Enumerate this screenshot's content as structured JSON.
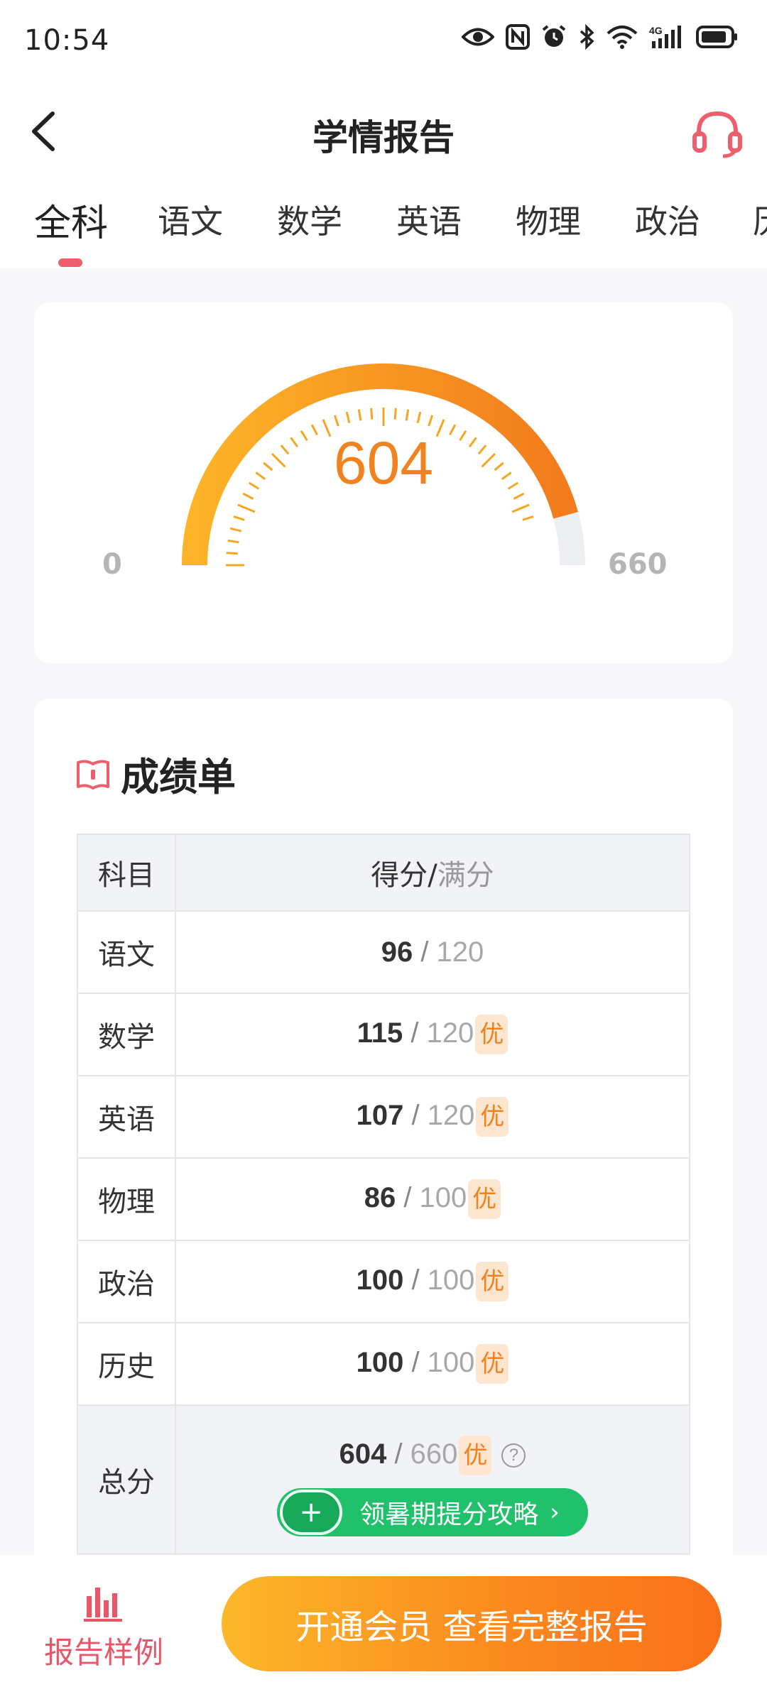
{
  "status_bar": {
    "time": "10:54",
    "icons": [
      "eye-icon",
      "nfc-icon",
      "alarm-icon",
      "bluetooth-icon",
      "wifi-icon",
      "signal-4g-icon",
      "battery-icon"
    ]
  },
  "nav": {
    "title": "学情报告",
    "back_icon": "chevron-left-icon",
    "support_icon": "headset-icon"
  },
  "tabs": [
    {
      "label": "全科",
      "active": true
    },
    {
      "label": "语文",
      "active": false
    },
    {
      "label": "数学",
      "active": false
    },
    {
      "label": "英语",
      "active": false
    },
    {
      "label": "物理",
      "active": false
    },
    {
      "label": "政治",
      "active": false
    },
    {
      "label": "历",
      "active": false
    }
  ],
  "gauge": {
    "score": "604",
    "min": "0",
    "max": "660",
    "fraction": 0.915
  },
  "report": {
    "title": "成绩单",
    "icon": "book-icon",
    "headers": {
      "subject": "科目",
      "score": "得分",
      "slash": "/",
      "full": "满分"
    },
    "rows": [
      {
        "subject": "语文",
        "score": "96",
        "full": "120",
        "badge": ""
      },
      {
        "subject": "数学",
        "score": "115",
        "full": "120",
        "badge": "优"
      },
      {
        "subject": "英语",
        "score": "107",
        "full": "120",
        "badge": "优"
      },
      {
        "subject": "物理",
        "score": "86",
        "full": "100",
        "badge": "优"
      },
      {
        "subject": "政治",
        "score": "100",
        "full": "100",
        "badge": "优"
      },
      {
        "subject": "历史",
        "score": "100",
        "full": "100",
        "badge": "优"
      }
    ],
    "total": {
      "subject": "总分",
      "score": "604",
      "full": "660",
      "badge": "优",
      "help": "?"
    },
    "strategy_button": {
      "plus": "+",
      "label": "领暑期提分攻略",
      "chevron": "›"
    }
  },
  "bottom": {
    "sample_label": "报告样例",
    "sample_icon": "bar-chart-icon",
    "cta_label": "开通会员 查看完整报告"
  },
  "colors": {
    "accent_red": "#ee5f6e",
    "gauge_orange": "#f08220",
    "gauge_yellow": "#fdb428",
    "strategy_green": "#21c16b"
  }
}
